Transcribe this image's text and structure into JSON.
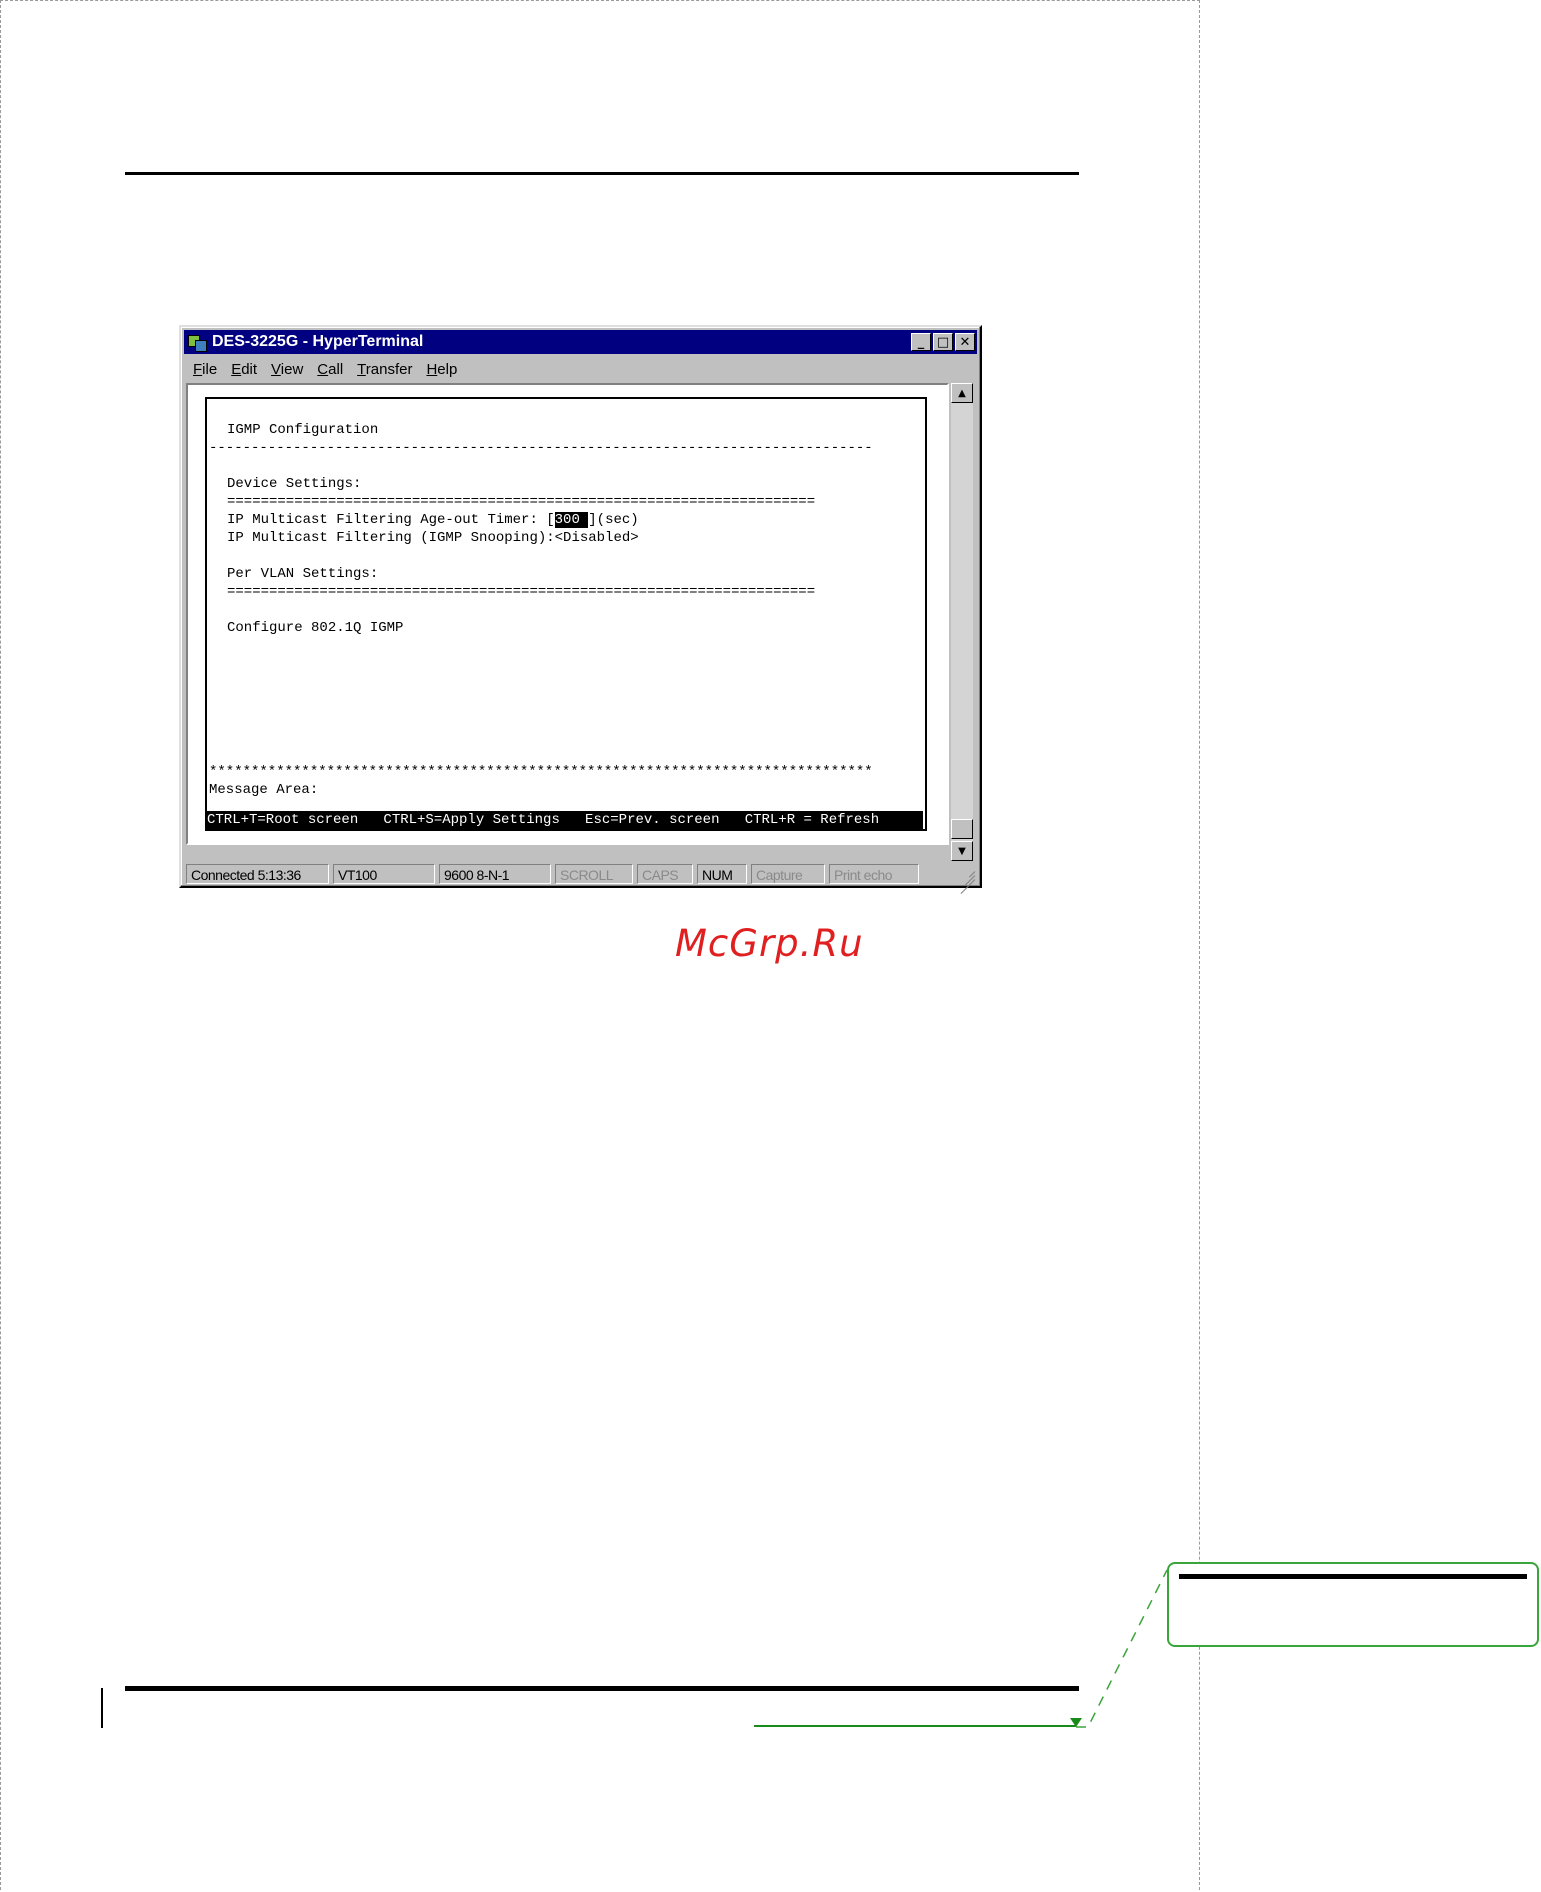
{
  "window": {
    "title": "DES-3225G - HyperTerminal",
    "minimize_glyph": "_",
    "maximize_glyph": "□",
    "close_glyph": "✕",
    "icon": "hyperterminal-app-icon"
  },
  "menu": {
    "items": [
      {
        "first": "F",
        "rest": "ile"
      },
      {
        "first": "E",
        "rest": "dit"
      },
      {
        "first": "V",
        "rest": "iew"
      },
      {
        "first": "C",
        "rest": "all"
      },
      {
        "first": "T",
        "rest": "ransfer"
      },
      {
        "first": "H",
        "rest": "elp"
      }
    ]
  },
  "terminal": {
    "heading": "IGMP Configuration",
    "divider_dash": "-------------------------------------------------------------------------------",
    "device_settings": "Device Settings:",
    "divider_eq": "======================================================================",
    "age_out_label": "IP Multicast Filtering Age-out Timer: [",
    "age_out_value": "300 ",
    "age_out_suffix": "](sec)",
    "snooping_line": "IP Multicast Filtering (IGMP Snooping):<Disabled>",
    "per_vlan": "Per VLAN Settings:",
    "configure": "Configure 802.1Q IGMP",
    "divider_star": "*******************************************************************************",
    "message_area": "Message Area:",
    "status_line": "CTRL+T=Root screen   CTRL+S=Apply Settings   Esc=Prev. screen   CTRL+R = Refresh"
  },
  "scrollbar": {
    "up_glyph": "▲",
    "down_glyph": "▼"
  },
  "statusbar": {
    "connected": "Connected 5:13:36",
    "emulation": "VT100",
    "port": "9600 8-N-1",
    "scroll": "SCROLL",
    "caps": "CAPS",
    "num": "NUM",
    "capture": "Capture",
    "print_echo": "Print echo"
  },
  "watermark": "McGrp.Ru",
  "colors": {
    "titlebar": "#000080",
    "watermark": "#e02020",
    "callout": "#3aa53a"
  }
}
